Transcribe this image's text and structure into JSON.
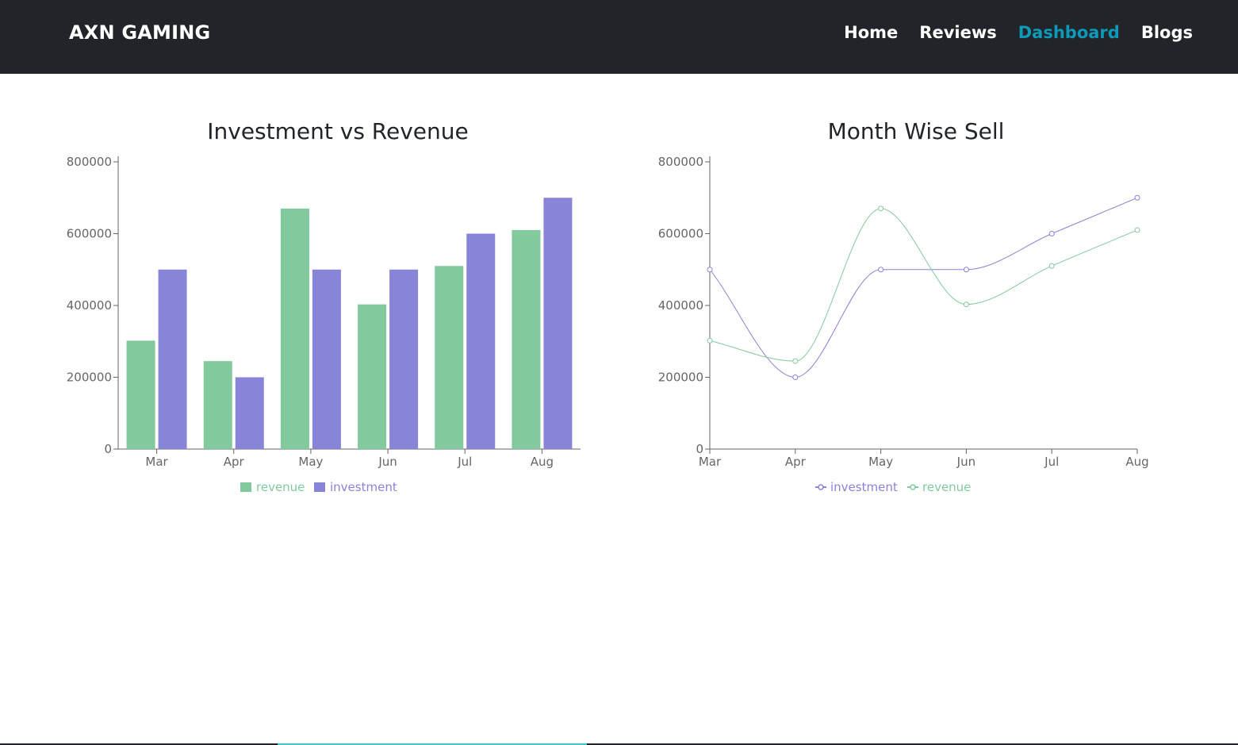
{
  "navbar": {
    "brand": "AXN GAMING",
    "links": [
      {
        "label": "Home",
        "active": false
      },
      {
        "label": "Reviews",
        "active": false
      },
      {
        "label": "Dashboard",
        "active": true
      },
      {
        "label": "Blogs",
        "active": false
      }
    ],
    "active_color": "#0d99b8"
  },
  "colors": {
    "revenue": "#82ca9d",
    "investment": "#8884d8"
  },
  "chart_data": [
    {
      "type": "bar",
      "title": "Investment vs Revenue",
      "categories": [
        "Mar",
        "Apr",
        "May",
        "Jun",
        "Jul",
        "Aug"
      ],
      "series": [
        {
          "name": "revenue",
          "values": [
            302000,
            245000,
            670000,
            403000,
            510000,
            610000
          ]
        },
        {
          "name": "investment",
          "values": [
            500000,
            200000,
            500000,
            500000,
            600000,
            700000
          ]
        }
      ],
      "yticks": [
        "0",
        "200000",
        "400000",
        "600000",
        "800000"
      ],
      "ylim": [
        0,
        800000
      ],
      "legend": "bottom-center",
      "grid": false
    },
    {
      "type": "line",
      "title": "Month Wise Sell",
      "categories": [
        "Mar",
        "Apr",
        "May",
        "Jun",
        "Jul",
        "Aug"
      ],
      "series": [
        {
          "name": "investment",
          "values": [
            500000,
            200000,
            500000,
            500000,
            600000,
            700000
          ]
        },
        {
          "name": "revenue",
          "values": [
            302000,
            245000,
            670000,
            403000,
            510000,
            610000
          ]
        }
      ],
      "yticks": [
        "0",
        "200000",
        "400000",
        "600000",
        "800000"
      ],
      "ylim": [
        0,
        800000
      ],
      "legend": "bottom-center",
      "grid": false,
      "curve": "smooth"
    }
  ]
}
